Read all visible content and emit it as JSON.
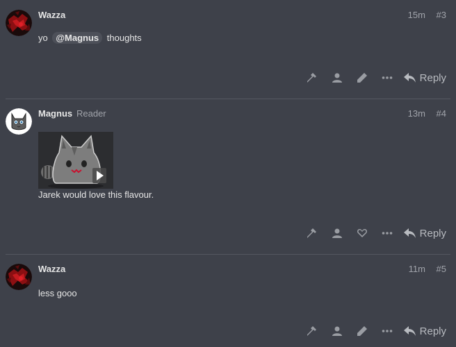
{
  "posts": [
    {
      "username": "Wazza",
      "user_title": "",
      "time": "15m",
      "post_number": "#3",
      "content_prefix": "yo",
      "mention": "@Magnus",
      "content_suffix": "thoughts",
      "actions": [
        "admin-wrench-icon",
        "user-icon",
        "edit-pencil-icon",
        "more-ellipsis-icon"
      ],
      "reply_label": "Reply"
    },
    {
      "username": "Magnus",
      "user_title": "Reader",
      "time": "13m",
      "post_number": "#4",
      "content": "Jarek would love this flavour.",
      "actions": [
        "admin-wrench-icon",
        "user-icon",
        "like-heart-icon",
        "more-ellipsis-icon"
      ],
      "reply_label": "Reply"
    },
    {
      "username": "Wazza",
      "user_title": "",
      "time": "11m",
      "post_number": "#5",
      "content": "less gooo",
      "actions": [
        "admin-wrench-icon",
        "user-icon",
        "edit-pencil-icon",
        "more-ellipsis-icon"
      ],
      "reply_label": "Reply"
    }
  ],
  "colors": {
    "background": "#3e414a",
    "divider": "#555861",
    "text": "#e6e6e6",
    "muted": "#a1a4ab"
  }
}
